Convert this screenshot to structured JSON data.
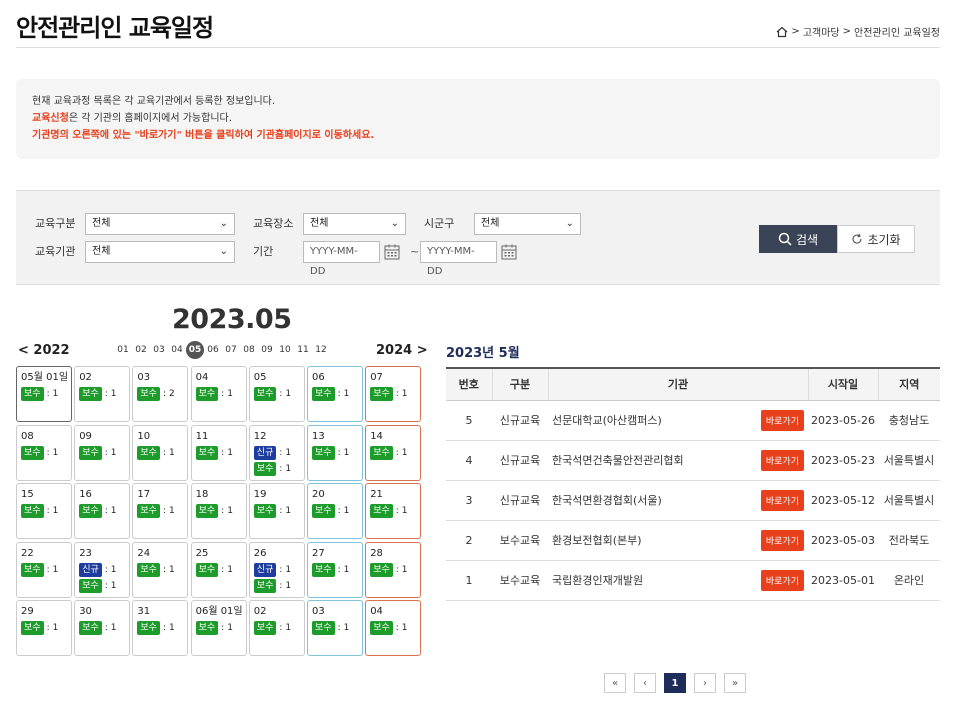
{
  "page_title": "안전관리인 교육일정",
  "breadcrumb": [
    "고객마당",
    "안전관리인 교육일정"
  ],
  "notice": {
    "line1": "현재 교육과정 목록은 각 교육기관에서 등록한 정보입니다.",
    "line2_strong": "교육신청",
    "line2_rest": "은 각 기관의 홈페이지에서 가능합니다.",
    "line3": "기관명의 오른쪽에 있는 \"바로가기\" 버튼을 클릭하여 기관홈페이지로 이동하세요."
  },
  "filter": {
    "category_label": "교육구분",
    "category_value": "전체",
    "place_label": "교육장소",
    "place_value": "전체",
    "district_label": "시군구",
    "district_value": "전체",
    "org_label": "교육기관",
    "org_value": "전체",
    "period_label": "기간",
    "date_placeholder": "YYYY-MM-DD",
    "search_label": "검색",
    "reset_label": "초기화"
  },
  "calendar": {
    "title": "2023.05",
    "prev_year": "2022",
    "next_year": "2024",
    "months": [
      "01",
      "02",
      "03",
      "04",
      "05",
      "06",
      "07",
      "08",
      "09",
      "10",
      "11",
      "12"
    ],
    "active_month": "05",
    "weeks": [
      [
        {
          "d": "05월 01일",
          "ev": [
            [
              "보수",
              "1"
            ]
          ]
        },
        {
          "d": "02",
          "ev": [
            [
              "보수",
              "1"
            ]
          ]
        },
        {
          "d": "03",
          "ev": [
            [
              "보수",
              "2"
            ]
          ]
        },
        {
          "d": "04",
          "ev": [
            [
              "보수",
              "1"
            ]
          ]
        },
        {
          "d": "05",
          "ev": [
            [
              "보수",
              "1"
            ]
          ]
        },
        {
          "d": "06",
          "ev": [
            [
              "보수",
              "1"
            ]
          ]
        },
        {
          "d": "07",
          "ev": [
            [
              "보수",
              "1"
            ]
          ]
        }
      ],
      [
        {
          "d": "08",
          "ev": [
            [
              "보수",
              "1"
            ]
          ]
        },
        {
          "d": "09",
          "ev": [
            [
              "보수",
              "1"
            ]
          ]
        },
        {
          "d": "10",
          "ev": [
            [
              "보수",
              "1"
            ]
          ]
        },
        {
          "d": "11",
          "ev": [
            [
              "보수",
              "1"
            ]
          ]
        },
        {
          "d": "12",
          "ev": [
            [
              "신규",
              "1"
            ],
            [
              "보수",
              "1"
            ]
          ]
        },
        {
          "d": "13",
          "ev": [
            [
              "보수",
              "1"
            ]
          ]
        },
        {
          "d": "14",
          "ev": [
            [
              "보수",
              "1"
            ]
          ]
        }
      ],
      [
        {
          "d": "15",
          "ev": [
            [
              "보수",
              "1"
            ]
          ]
        },
        {
          "d": "16",
          "ev": [
            [
              "보수",
              "1"
            ]
          ]
        },
        {
          "d": "17",
          "ev": [
            [
              "보수",
              "1"
            ]
          ]
        },
        {
          "d": "18",
          "ev": [
            [
              "보수",
              "1"
            ]
          ]
        },
        {
          "d": "19",
          "ev": [
            [
              "보수",
              "1"
            ]
          ]
        },
        {
          "d": "20",
          "ev": [
            [
              "보수",
              "1"
            ]
          ]
        },
        {
          "d": "21",
          "ev": [
            [
              "보수",
              "1"
            ]
          ]
        }
      ],
      [
        {
          "d": "22",
          "ev": [
            [
              "보수",
              "1"
            ]
          ]
        },
        {
          "d": "23",
          "ev": [
            [
              "신규",
              "1"
            ],
            [
              "보수",
              "1"
            ]
          ]
        },
        {
          "d": "24",
          "ev": [
            [
              "보수",
              "1"
            ]
          ]
        },
        {
          "d": "25",
          "ev": [
            [
              "보수",
              "1"
            ]
          ]
        },
        {
          "d": "26",
          "ev": [
            [
              "신규",
              "1"
            ],
            [
              "보수",
              "1"
            ]
          ]
        },
        {
          "d": "27",
          "ev": [
            [
              "보수",
              "1"
            ]
          ]
        },
        {
          "d": "28",
          "ev": [
            [
              "보수",
              "1"
            ]
          ]
        }
      ],
      [
        {
          "d": "29",
          "ev": [
            [
              "보수",
              "1"
            ]
          ]
        },
        {
          "d": "30",
          "ev": [
            [
              "보수",
              "1"
            ]
          ]
        },
        {
          "d": "31",
          "ev": [
            [
              "보수",
              "1"
            ]
          ]
        },
        {
          "d": "06월 01일",
          "ev": [
            [
              "보수",
              "1"
            ]
          ]
        },
        {
          "d": "02",
          "ev": [
            [
              "보수",
              "1"
            ]
          ]
        },
        {
          "d": "03",
          "ev": [
            [
              "보수",
              "1"
            ]
          ]
        },
        {
          "d": "04",
          "ev": [
            [
              "보수",
              "1"
            ]
          ]
        }
      ]
    ]
  },
  "table": {
    "title": "2023년 5월",
    "headers": [
      "번호",
      "구분",
      "기관",
      "시작일",
      "지역"
    ],
    "go_label": "바로가기",
    "rows": [
      {
        "no": "5",
        "type": "신규교육",
        "org": "선문대학교(아산캠퍼스)",
        "start": "2023-05-26",
        "region": "충청남도"
      },
      {
        "no": "4",
        "type": "신규교육",
        "org": "한국석면건축물안전관리협회",
        "start": "2023-05-23",
        "region": "서울특별시"
      },
      {
        "no": "3",
        "type": "신규교육",
        "org": "한국석면환경협회(서울)",
        "start": "2023-05-12",
        "region": "서울특별시"
      },
      {
        "no": "2",
        "type": "보수교육",
        "org": "환경보전협회(본부)",
        "start": "2023-05-03",
        "region": "전라북도"
      },
      {
        "no": "1",
        "type": "보수교육",
        "org": "국립환경인재개발원",
        "start": "2023-05-01",
        "region": "온라인"
      }
    ]
  },
  "pager": {
    "first": "«",
    "prev": "‹",
    "current": "1",
    "next": "›",
    "last": "»"
  },
  "colors": {
    "accent_red": "#e8401c",
    "navy": "#1d2d5a",
    "green_badge": "#1d9b2b",
    "blue_badge": "#1f3d9e"
  }
}
